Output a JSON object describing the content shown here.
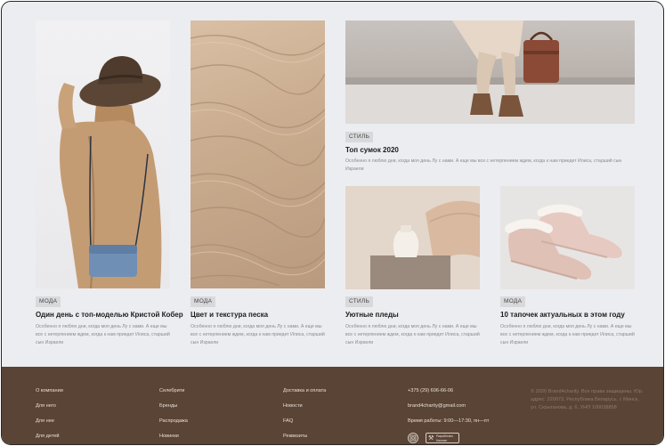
{
  "cards": [
    {
      "tag": "МОДА",
      "title": "Один день с топ-моделью Кристой Кобер",
      "desc": "Особенно я люблю дни, когда моя день Лу с нами. А еще мы все с нетерпением ждем, когда к нам приедет Илиса, старший сын Израели"
    },
    {
      "tag": "МОДА",
      "title": "Цвет и текстура песка",
      "desc": "Особенно я люблю дни, когда моя день Лу с нами. А еще мы все с нетерпением ждем, когда к нам приедет Илиса, старший сын Израели"
    },
    {
      "tag": "СТИЛЬ",
      "title": "Топ сумок 2020",
      "desc": "Особенно я люблю дни, когда моя день Лу с нами. А еще мы все с нетерпением ждем, когда к нам приедет Илиса, старший сын Израели"
    },
    {
      "tag": "СТИЛЬ",
      "title": "Уютные пледы",
      "desc": "Особенно я люблю дни, когда моя день Лу с нами. А еще мы все с нетерпением ждем, когда к нам приедет Илиса, старший сын Израели"
    },
    {
      "tag": "МОДА",
      "title": "10 тапочек актуальных в этом году",
      "desc": "Особенно я люблю дни, когда моя день Лу с нами. А еще мы все с нетерпением ждем, когда к нам приедет Илиса, старший сын Израели"
    }
  ],
  "footer": {
    "col1": [
      "О компании",
      "Для него",
      "Для нее",
      "Для детей"
    ],
    "col2": [
      "Селебрити",
      "Бренды",
      "Распродажа",
      "Новинки"
    ],
    "col3": [
      "Доставка и оплата",
      "Новости",
      "FAQ",
      "Реквизиты"
    ],
    "phone": "+375 (29) 606-66-06",
    "email": "brand4charity@gmail.com",
    "hours": "Время работы: 9:00—17:30, пн—пт",
    "copyright": "© 2020 Brand4charity. Все права защищены. Юр. адрес: 220073, Республика Беларусь, г. Минск, ул. Скрыганова, д. 6, УНП 100038858",
    "instagram_icon": "instagram-icon",
    "partner_badge": "Разработано Hammer"
  }
}
